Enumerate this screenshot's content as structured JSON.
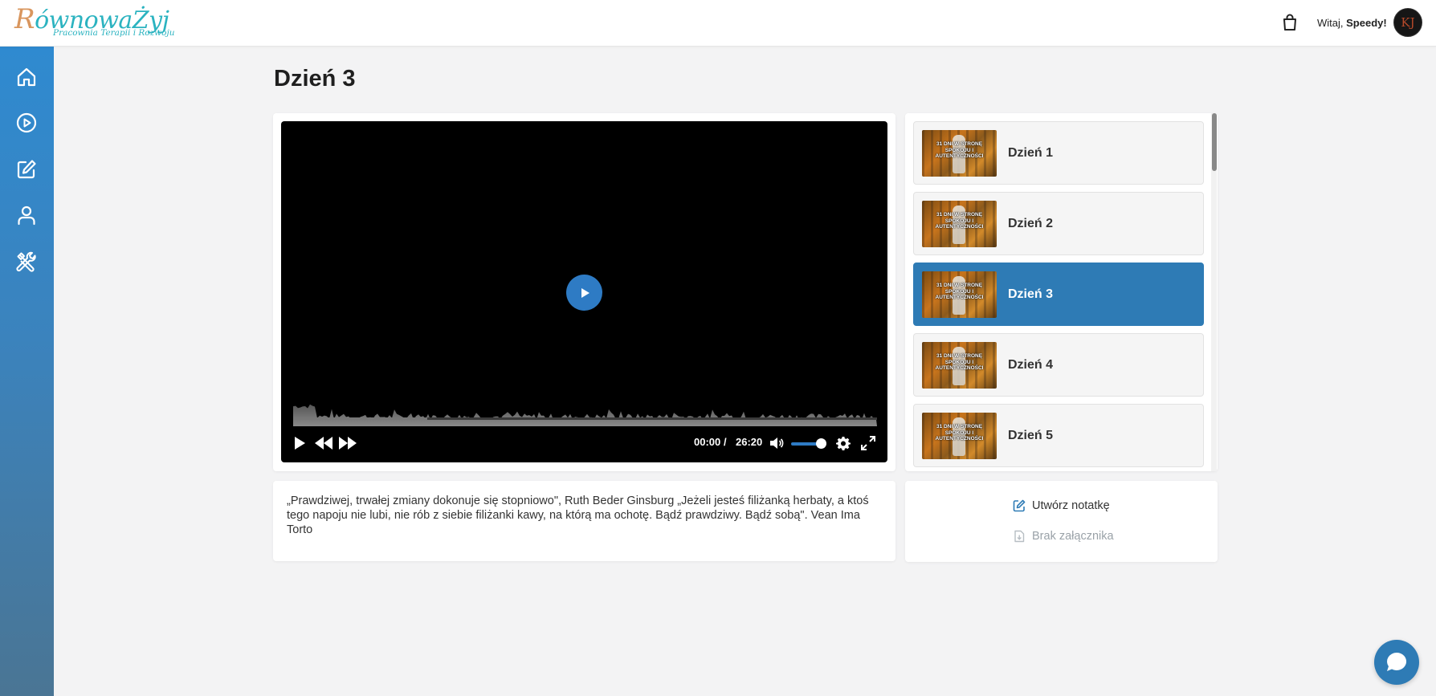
{
  "header": {
    "logo_text_first": "R",
    "logo_text_rest": "ównowaŻyj",
    "logo_subtitle": "Pracownia Terapii i Rozwoju",
    "greeting_prefix": "Witaj,",
    "user_name": "Speedy!",
    "avatar_initials": "KJ"
  },
  "sidebar": {
    "items": [
      {
        "icon": "home-icon"
      },
      {
        "icon": "play-circle-icon"
      },
      {
        "icon": "edit-icon"
      },
      {
        "icon": "user-icon"
      },
      {
        "icon": "tools-icon"
      }
    ]
  },
  "main": {
    "title": "Dzień 3",
    "player": {
      "current_time": "00:00",
      "separator": "/",
      "duration": "26:20",
      "progress_fraction": 0.0,
      "buffered_fraction": 0.23,
      "volume_fraction": 0.85
    },
    "description": "„Prawdziwej, trwałej zmiany dokonuje się stopniowo\", Ruth Beder Ginsburg „Jeżeli jesteś filiżanką herbaty, a ktoś tego napoju nie lubi, nie rób z siebie filiżanki kawy, na którą ma ochotę. Bądź prawdziwy. Bądź sobą\". Vean Ima Torto",
    "lessons": [
      {
        "label": "Dzień 1",
        "thumb_text": "31 DNI W STRONĘ SPOKOJU I AUTENTYCZNOŚCI",
        "active": false
      },
      {
        "label": "Dzień 2",
        "thumb_text": "31 DNI W STRONĘ SPOKOJU I AUTENTYCZNOŚCI",
        "active": false
      },
      {
        "label": "Dzień 3",
        "thumb_text": "31 DNI W STRONĘ SPOKOJU I AUTENTYCZNOŚCI",
        "active": true
      },
      {
        "label": "Dzień 4",
        "thumb_text": "31 DNI W STRONĘ SPOKOJU I AUTENTYCZNOŚCI",
        "active": false
      },
      {
        "label": "Dzień 5",
        "thumb_text": "31 DNI W STRONĘ SPOKOJU I AUTENTYCZNOŚCI",
        "active": false
      }
    ],
    "notes": {
      "create_note_label": "Utwórz notatkę",
      "no_attachment_label": "Brak załącznika"
    }
  },
  "colors": {
    "accent": "#2e7bb5",
    "sidebar_top": "#2f8ad0",
    "sidebar_bottom": "#4a7594",
    "logo_teal": "#2bb3c0",
    "logo_orange": "#d9965e"
  }
}
